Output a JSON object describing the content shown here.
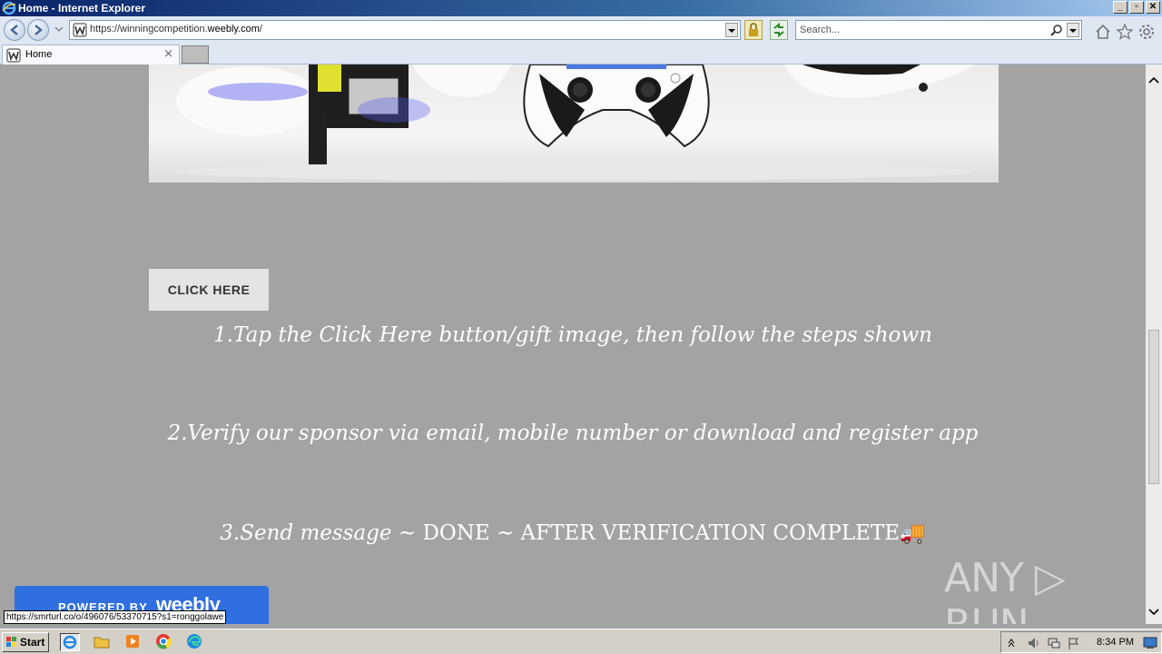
{
  "window": {
    "title": "Home - Internet Explorer",
    "buttons": [
      "_",
      "▫",
      "✕"
    ]
  },
  "nav": {
    "url_prefix": "https://winningcompetition.",
    "url_host": "weebly.com",
    "url_suffix": "/",
    "search_placeholder": "Search..."
  },
  "tabs": [
    {
      "label": "Home",
      "close": "×"
    }
  ],
  "page": {
    "click_button": "CLICK HERE",
    "step1": "1.Tap the Click Here button/gift image, then follow the steps shown",
    "step2": "2.Verify our sponsor via email, mobile number or download and register app",
    "step3_italic": "3.Send message ~ ",
    "step3_upper": "DONE ~ AFTER VERIFICATION COMPLETE",
    "step3_emoji": "🚚",
    "powered_label": "POWERED BY",
    "powered_brand": "weebly"
  },
  "status": {
    "hover_url": "https://smrturl.co/o/496076/53370715?s1=ronggolawe"
  },
  "watermark": "ANY ▷ RUN",
  "taskbar": {
    "start_label": "Start",
    "clock": "8:34 PM"
  },
  "colors": {
    "page_bg": "#a3a3a3",
    "button_bg": "#e4e4e4",
    "powered_bg": "#2f6fe0"
  }
}
